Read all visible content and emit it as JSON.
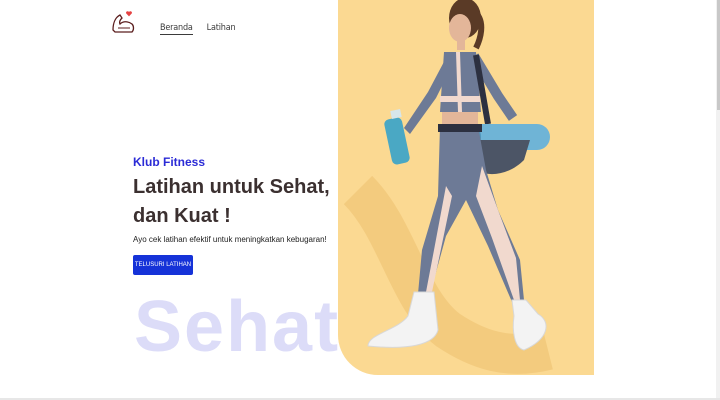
{
  "nav": {
    "items": [
      "Beranda",
      "Latihan"
    ]
  },
  "hero": {
    "subtitle": "Klub Fitness",
    "headline_line1": "Latihan untuk Sehat,",
    "headline_line2": "dan Kuat !",
    "description": "Ayo cek latihan efektif untuk meningkatkan kebugaran!",
    "cta_label": "TELUSURI LATIHAN",
    "background_word": "Sehat"
  },
  "colors": {
    "accent": "#1532d8",
    "subtitle": "#2b2bd6",
    "hero_bg": "#fbd992",
    "ghost_text": "#dcdcf8"
  }
}
